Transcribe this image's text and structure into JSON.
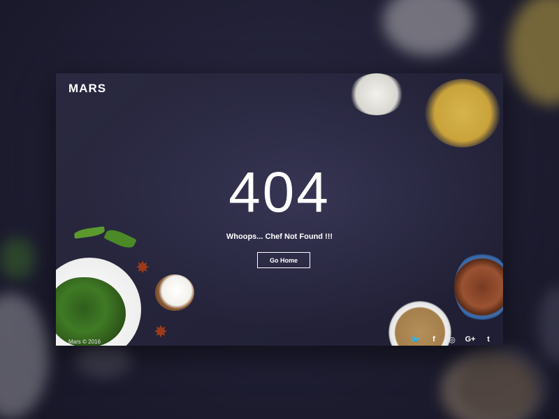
{
  "brand": {
    "logo": "MARS"
  },
  "error": {
    "code": "404",
    "message": "Whoops... Chef Not Found !!!",
    "button_label": "Go Home"
  },
  "footer": {
    "copyright": "Mars © 2016"
  },
  "social": [
    {
      "name": "twitter",
      "glyph": "🐦"
    },
    {
      "name": "facebook",
      "glyph": "f"
    },
    {
      "name": "instagram",
      "glyph": "◎"
    },
    {
      "name": "google-plus",
      "glyph": "G+"
    },
    {
      "name": "tumblr",
      "glyph": "t"
    }
  ],
  "colors": {
    "background": "#24233a",
    "text": "#ffffff"
  }
}
